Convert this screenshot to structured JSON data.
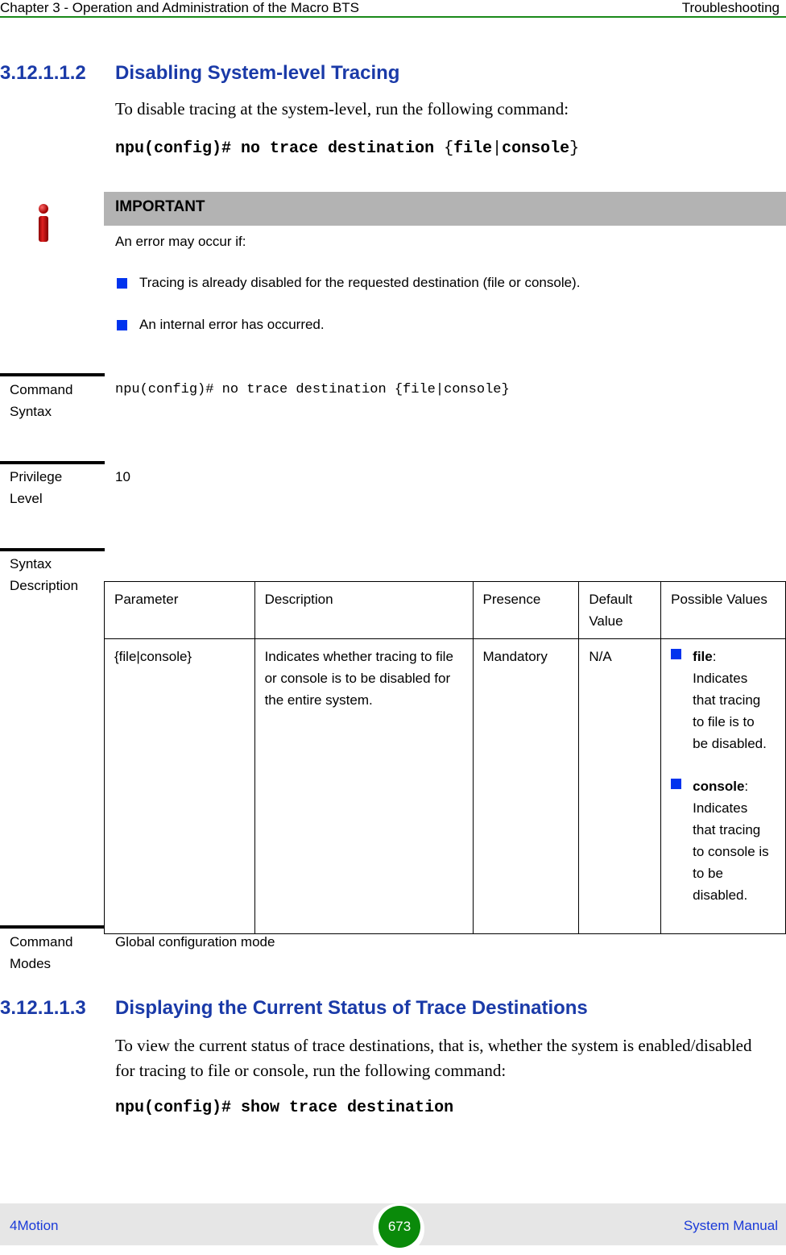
{
  "header": {
    "chapter": "Chapter 3 - Operation and Administration of the Macro BTS",
    "section": "Troubleshooting"
  },
  "section_1": {
    "number": "3.12.1.1.2",
    "title": "Disabling System-level Tracing",
    "intro": "To disable tracing at the system-level, run the following command:",
    "command_prefix": "npu(config)# no trace destination ",
    "command_brace_open": "{",
    "command_opt1": "file",
    "command_sep": "|",
    "command_opt2": "console",
    "command_brace_close": "}"
  },
  "important": {
    "icon": "info-icon",
    "title": "IMPORTANT",
    "lead": "An error may occur if:",
    "bullets": [
      "Tracing is already disabled for the requested destination (file or console).",
      "An internal error has occurred."
    ]
  },
  "command_syntax": {
    "label_line1": "Command",
    "label_line2": "Syntax",
    "value": "npu(config)# no trace destination {file|console}"
  },
  "privilege_level": {
    "label_line1": "Privilege",
    "label_line2": "Level",
    "value": "10"
  },
  "syntax_description": {
    "label_line1": "Syntax",
    "label_line2": "Description",
    "columns": [
      "Parameter",
      "Description",
      "Presence",
      "Default Value",
      "Possible Values"
    ],
    "rows": [
      {
        "parameter": "{file|console}",
        "description": "Indicates whether tracing to file or console is to be disabled for the entire system.",
        "presence": "Mandatory",
        "default": "N/A",
        "possible_values": [
          {
            "term": "file",
            "text": ": Indicates that tracing to file is to be disabled."
          },
          {
            "term": "console",
            "text": ": Indicates that tracing to console is to be disabled."
          }
        ]
      }
    ]
  },
  "command_modes": {
    "label_line1": "Command",
    "label_line2": "Modes",
    "value": "Global configuration mode"
  },
  "section_2": {
    "number": "3.12.1.1.3",
    "title": "Displaying the Current Status of Trace Destinations",
    "intro": "To view the current status of trace destinations, that is, whether the system is enabled/disabled for tracing to file or console, run the following command:",
    "command": "npu(config)# show trace destination"
  },
  "footer": {
    "product": "4Motion",
    "page": "673",
    "manual": "System Manual"
  }
}
